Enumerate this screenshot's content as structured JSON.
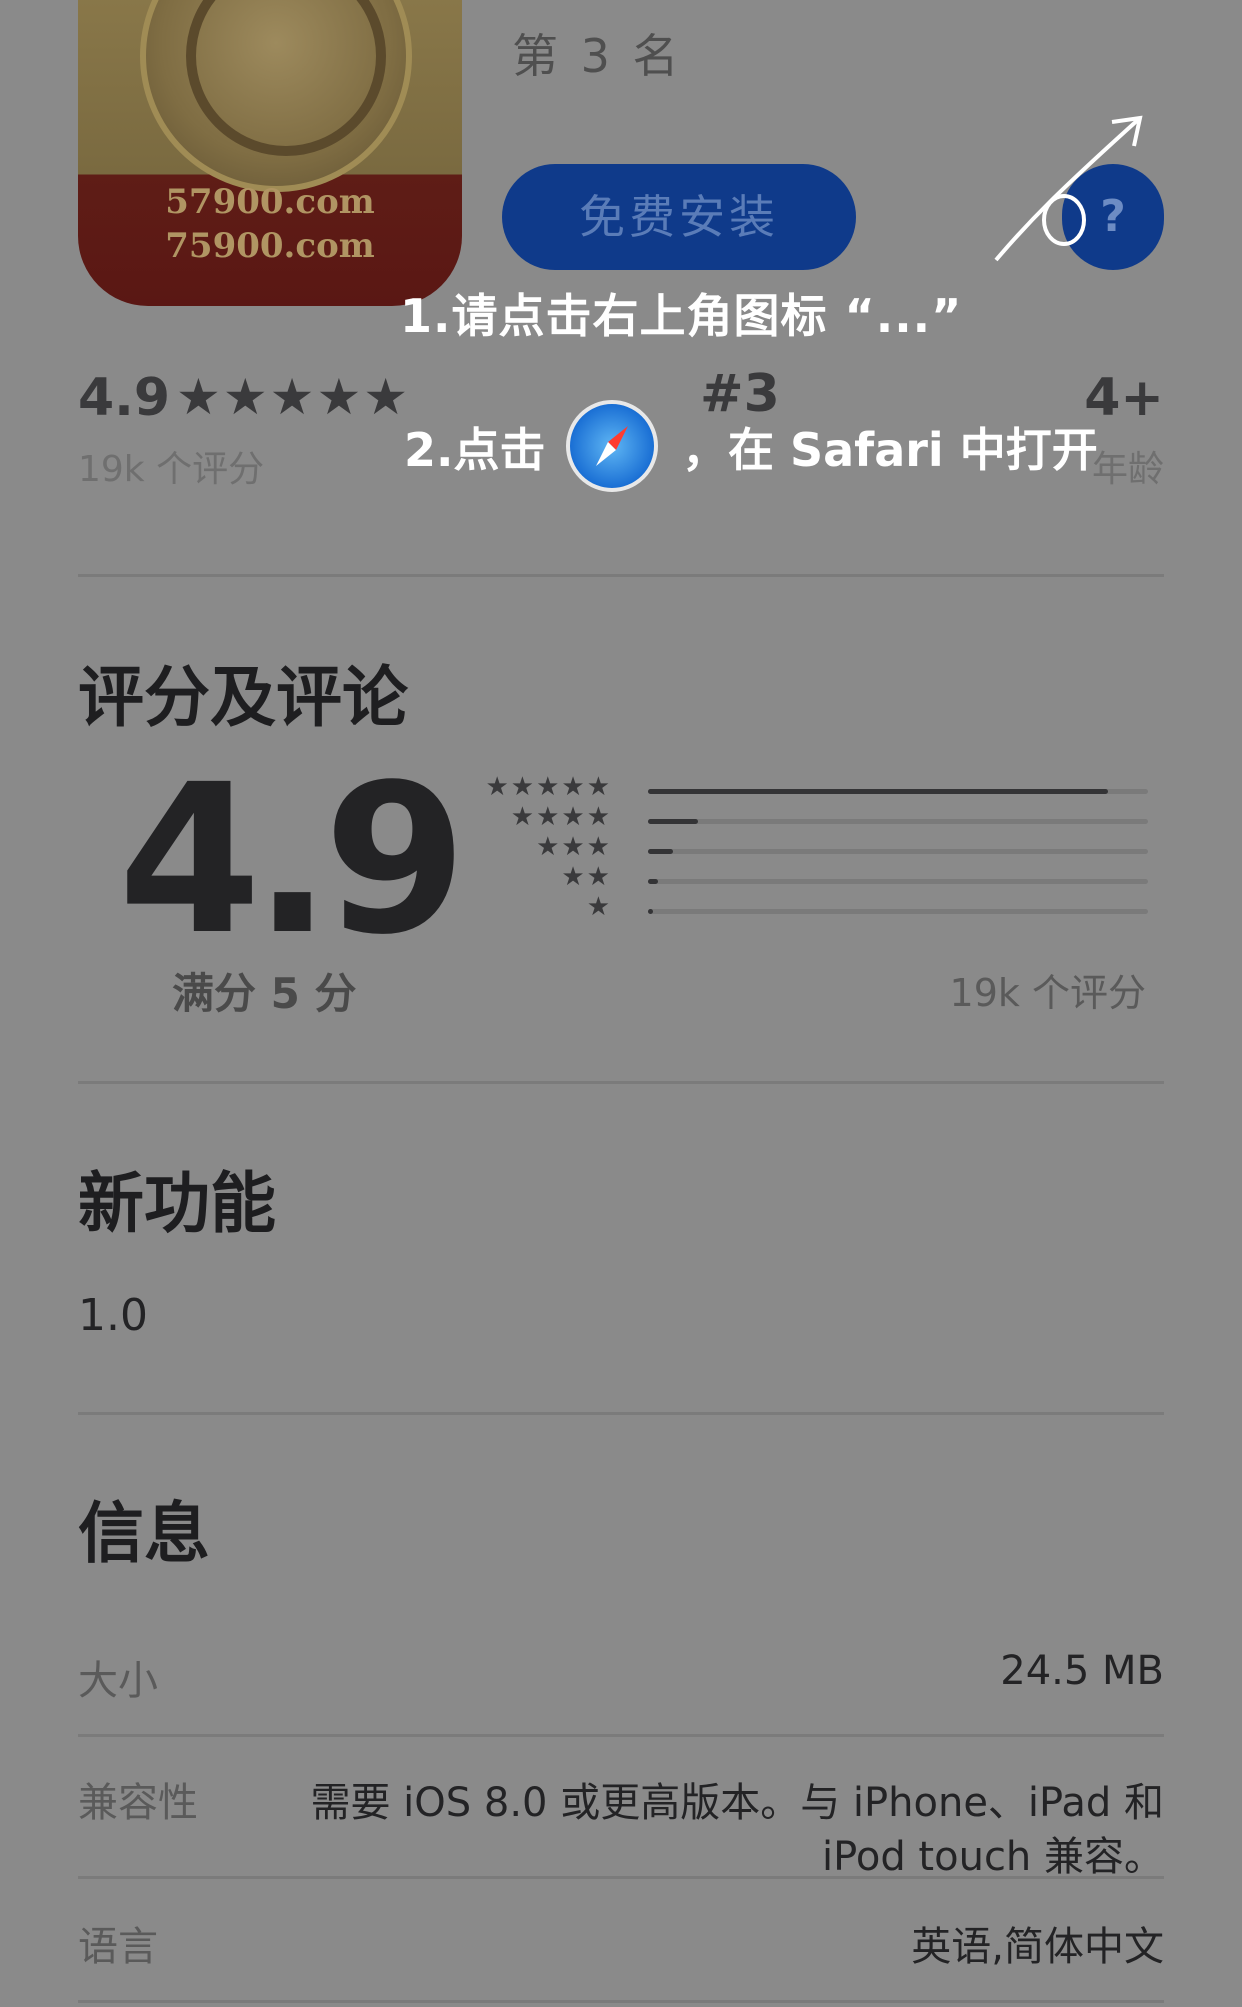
{
  "header": {
    "icon_domain_1": "57900.com",
    "icon_domain_2": "75900.com",
    "rank": "第 3 名",
    "install_label": "免费安装",
    "help_label": "?"
  },
  "overlay": {
    "step1": "1.请点击右上角图标 “...”",
    "step2_prefix": "2.点击",
    "step2_suffix": "，在 Safari 中打开",
    "safari_icon": "safari-compass-icon"
  },
  "stats": {
    "rating_value": "4.9",
    "rating_stars": "★★★★★",
    "rating_count": "19k 个评分",
    "rank_value": "#3",
    "age_value": "4+",
    "age_label": "年龄"
  },
  "ratings": {
    "title": "评分及评论",
    "big_value": "4.9",
    "out_of": "满分 5 分",
    "count": "19k 个评分",
    "distribution": [
      {
        "stars": "★★★★★",
        "fraction": 0.92
      },
      {
        "stars": "★★★★",
        "fraction": 0.1
      },
      {
        "stars": "★★★",
        "fraction": 0.05
      },
      {
        "stars": "★★",
        "fraction": 0.02
      },
      {
        "stars": "★",
        "fraction": 0.01
      }
    ]
  },
  "whats_new": {
    "title": "新功能",
    "version": "1.0"
  },
  "info": {
    "title": "信息",
    "size_label": "大小",
    "size_value": "24.5 MB",
    "compat_label": "兼容性",
    "compat_line1": "需要 iOS 8.0 或更高版本。与 iPhone、iPad 和",
    "compat_line2": "iPod touch 兼容。",
    "lang_label": "语言",
    "lang_value": "英语,简体中文"
  },
  "colors": {
    "dim_overlay_bg": "#8a8a8a",
    "button_blue": "#0f3a8a",
    "overlay_text": "#ffffff"
  }
}
